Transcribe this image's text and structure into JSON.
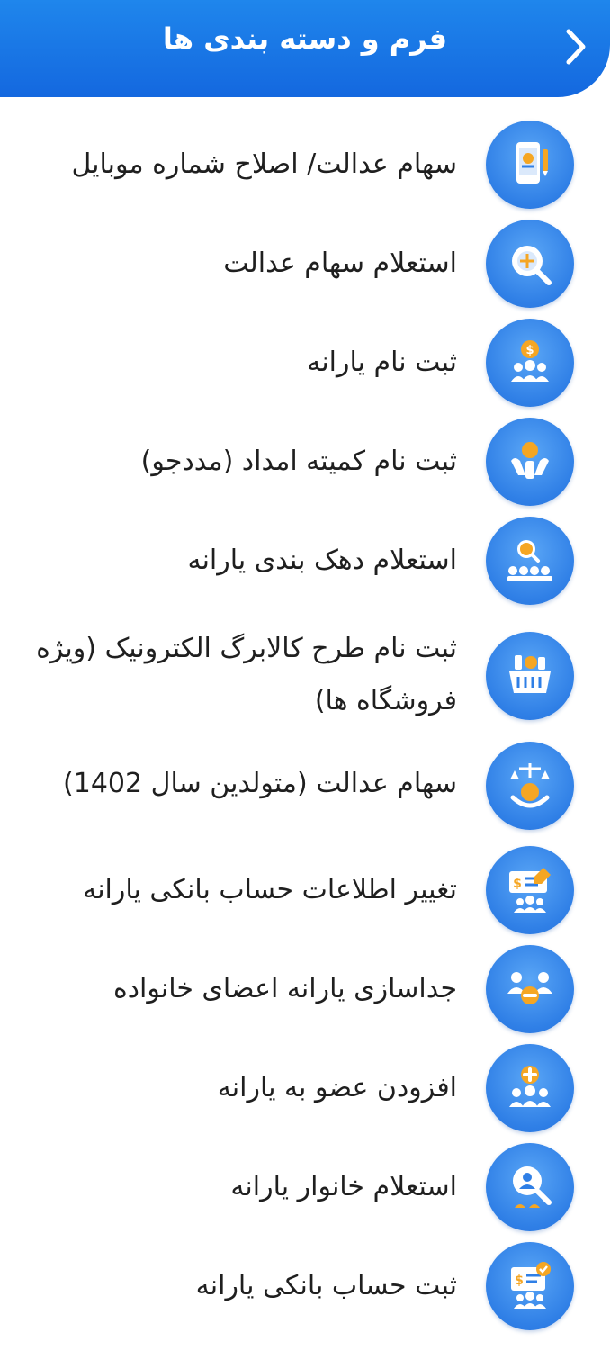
{
  "header": {
    "title": "فرم و دسته بندی ها",
    "back_icon": "chevron-right-icon"
  },
  "colors": {
    "header_blue": "#1468df",
    "icon_blue": "#2f7fe6",
    "icon_accent": "#f5a623",
    "text": "#1f1f1f"
  },
  "items": [
    {
      "label": "سهام عدالت/ اصلاح شماره موبایل",
      "icon": "mobile-justice-icon"
    },
    {
      "label": "استعلام سهام عدالت",
      "icon": "justice-inquiry-icon"
    },
    {
      "label": "ثبت نام یارانه",
      "icon": "subsidy-register-icon"
    },
    {
      "label": "ثبت نام کمیته امداد (مددجو)",
      "icon": "relief-committee-icon"
    },
    {
      "label": "استعلام دهک بندی یارانه",
      "icon": "decile-inquiry-icon"
    },
    {
      "label": "ثبت نام طرح کالابرگ الکترونیک (ویژه فروشگاه ها)",
      "icon": "shopping-basket-icon"
    },
    {
      "label": "سهام عدالت (متولدین سال 1402)",
      "icon": "baby-justice-icon"
    },
    {
      "label": "تغییر اطلاعات حساب بانکی یارانه",
      "icon": "bank-edit-icon"
    },
    {
      "label": "جداسازی یارانه اعضای خانواده",
      "icon": "family-split-icon"
    },
    {
      "label": "افزودن عضو به یارانه",
      "icon": "add-member-icon"
    },
    {
      "label": "استعلام خانوار یارانه",
      "icon": "household-inquiry-icon"
    },
    {
      "label": "ثبت حساب بانکی یارانه",
      "icon": "bank-register-icon"
    }
  ]
}
